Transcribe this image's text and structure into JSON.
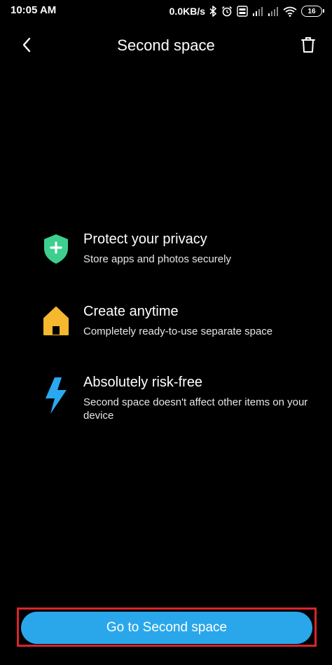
{
  "status_bar": {
    "time": "10:05 AM",
    "net_speed": "0.0KB/s",
    "battery_level": "16",
    "icons": [
      "bluetooth-icon",
      "alarm-icon",
      "volte-icon",
      "signal-icon",
      "signal-icon",
      "wifi-icon",
      "battery-icon"
    ]
  },
  "header": {
    "title": "Second space",
    "back_icon": "chevron-left-icon",
    "delete_icon": "trash-icon"
  },
  "features": [
    {
      "icon": "shield-plus-icon",
      "icon_color": "#3ecf8e",
      "title": "Protect your privacy",
      "description": "Store apps and photos securely"
    },
    {
      "icon": "house-icon",
      "icon_color": "#f5b82e",
      "title": "Create anytime",
      "description": "Completely ready-to-use separate space"
    },
    {
      "icon": "lightning-icon",
      "icon_color": "#29a9f0",
      "title": "Absolutely risk-free",
      "description": "Second space doesn't affect other items on your device"
    }
  ],
  "cta": {
    "label": "Go to Second space",
    "color": "#2aa7ea",
    "highlight_color": "#d9252b"
  }
}
